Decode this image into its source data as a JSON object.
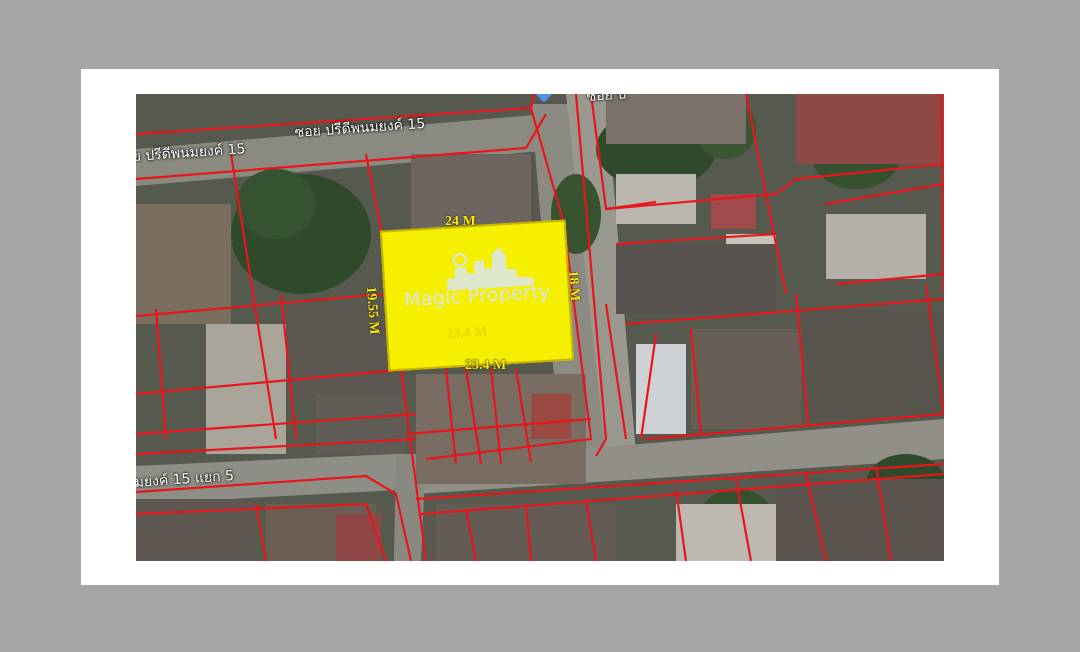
{
  "map": {
    "streets": {
      "top_road": "ซอย ปรีดีพนมยงค์ 15",
      "top_road_left": "ย ปรีดีพนมยงค์ 15",
      "top_right_road": "ซอย ป",
      "bottom_road": "มยงค์ 15 แยก 5"
    },
    "plot": {
      "highlight_color": "#f5f000",
      "watermark": "Magic Property",
      "dimensions": {
        "top": "24 M",
        "right": "18 M",
        "left": "19.55 M",
        "bottom": "23.4 M",
        "bottom_inner": "23.4 M"
      }
    },
    "boundary_color": "#e8151b",
    "pin_icon": "location-pin-icon"
  }
}
